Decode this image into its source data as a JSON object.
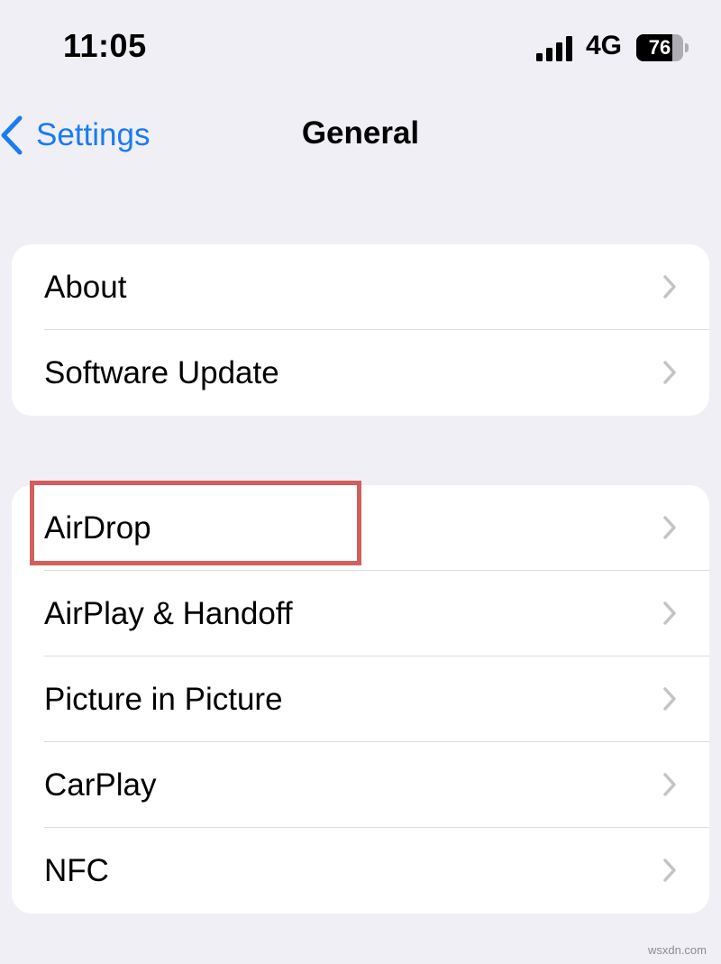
{
  "status_bar": {
    "time": "11:05",
    "network": "4G",
    "battery_level": "76",
    "battery_fraction": 0.76,
    "signal_icon": "cellular-signal-icon",
    "battery_icon": "battery-icon"
  },
  "nav": {
    "back_label": "Settings",
    "back_icon": "chevron-left-icon",
    "title": "General"
  },
  "groups": [
    {
      "items": [
        {
          "label": "About"
        },
        {
          "label": "Software Update"
        }
      ]
    },
    {
      "items": [
        {
          "label": "AirDrop",
          "highlighted": true
        },
        {
          "label": "AirPlay & Handoff"
        },
        {
          "label": "Picture in Picture"
        },
        {
          "label": "CarPlay"
        },
        {
          "label": "NFC"
        }
      ]
    }
  ],
  "colors": {
    "background": "#f0eff5",
    "accent": "#1a7cf2",
    "highlight": "#d25f5c",
    "card": "#ffffff"
  },
  "watermark": "wsxdn.com"
}
